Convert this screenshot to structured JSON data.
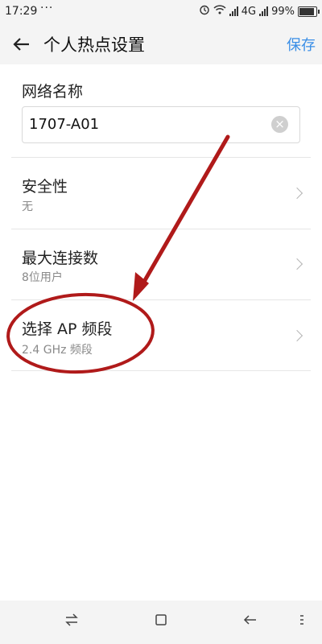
{
  "status_bar": {
    "time": "17:29",
    "dots": "···",
    "network": "4G",
    "battery": "99%",
    "icons": [
      "alarm-icon",
      "wifi-icon",
      "signal-icon",
      "signal-icon",
      "battery-icon"
    ]
  },
  "app_bar": {
    "title": "个人热点设置",
    "save": "保存",
    "back_icon": "arrow-left-icon"
  },
  "network_name": {
    "label": "网络名称",
    "value": "1707-A01"
  },
  "settings": [
    {
      "label": "安全性",
      "value": "无"
    },
    {
      "label": "最大连接数",
      "value": "8位用户"
    },
    {
      "label": "选择 AP 频段",
      "value": "2.4 GHz 频段"
    }
  ],
  "nav_bar": {
    "icons": [
      "swap-icon",
      "home-icon",
      "back-icon",
      "menu-icon"
    ]
  },
  "colors": {
    "accent": "#3a8ee6",
    "annotation": "#b01a1a"
  }
}
